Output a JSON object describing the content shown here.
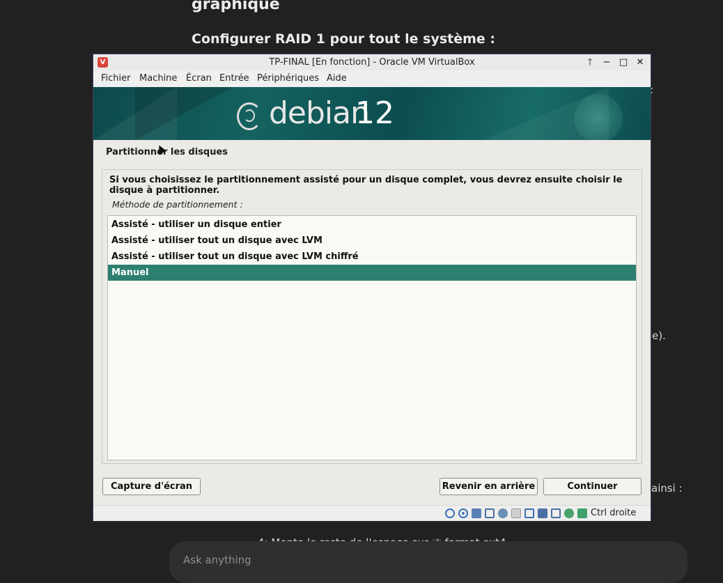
{
  "background": {
    "heading_top": "graphique",
    "heading": "Configurer RAID 1 pour tout le système :",
    "frag_colon": ":",
    "frag_paren": "e).",
    "frag_ainsi": "ainsi :",
    "bottom_line_start": "4: Monte le reste de l'espace sur",
    "bottom_code": "/",
    "bottom_line_end": "format ext4",
    "chat_placeholder": "Ask anything"
  },
  "window": {
    "title": "TP-FINAL [En fonction] - Oracle VM VirtualBox",
    "menu": [
      "Fichier",
      "Machine",
      "Écran",
      "Entrée",
      "Périphériques",
      "Aide"
    ],
    "buttons": {
      "up": "🡑",
      "minimize": "−",
      "maximize": "□",
      "close": "✕"
    }
  },
  "installer": {
    "brand_word": "debian",
    "brand_version": "12",
    "step_title": "Partitionner les disques",
    "question": "Si vous choisissez le partitionnement assisté pour un disque complet, vous devrez ensuite choisir le disque à partitionner.",
    "list_label": "Méthode de partitionnement :",
    "options": [
      "Assisté - utiliser un disque entier",
      "Assisté - utiliser tout un disque avec LVM",
      "Assisté - utiliser tout un disque avec LVM chiffré",
      "Manuel"
    ],
    "selected_index": 3,
    "buttons": {
      "screenshot": "Capture d'écran",
      "back": "Revenir en arrière",
      "continue": "Continuer"
    }
  },
  "statusbar": {
    "icons": [
      "hard-disk-icon",
      "optical-drive-icon",
      "audio-icon",
      "network-icon",
      "usb-icon",
      "shared-folders-icon",
      "display-icon",
      "video-capture-icon",
      "virtualization-icon",
      "mouse-integration-icon",
      "keyboard-icon"
    ],
    "host_key": "Ctrl droite"
  },
  "colors": {
    "selection": "#2d7f6f",
    "banner": "#14625f"
  }
}
